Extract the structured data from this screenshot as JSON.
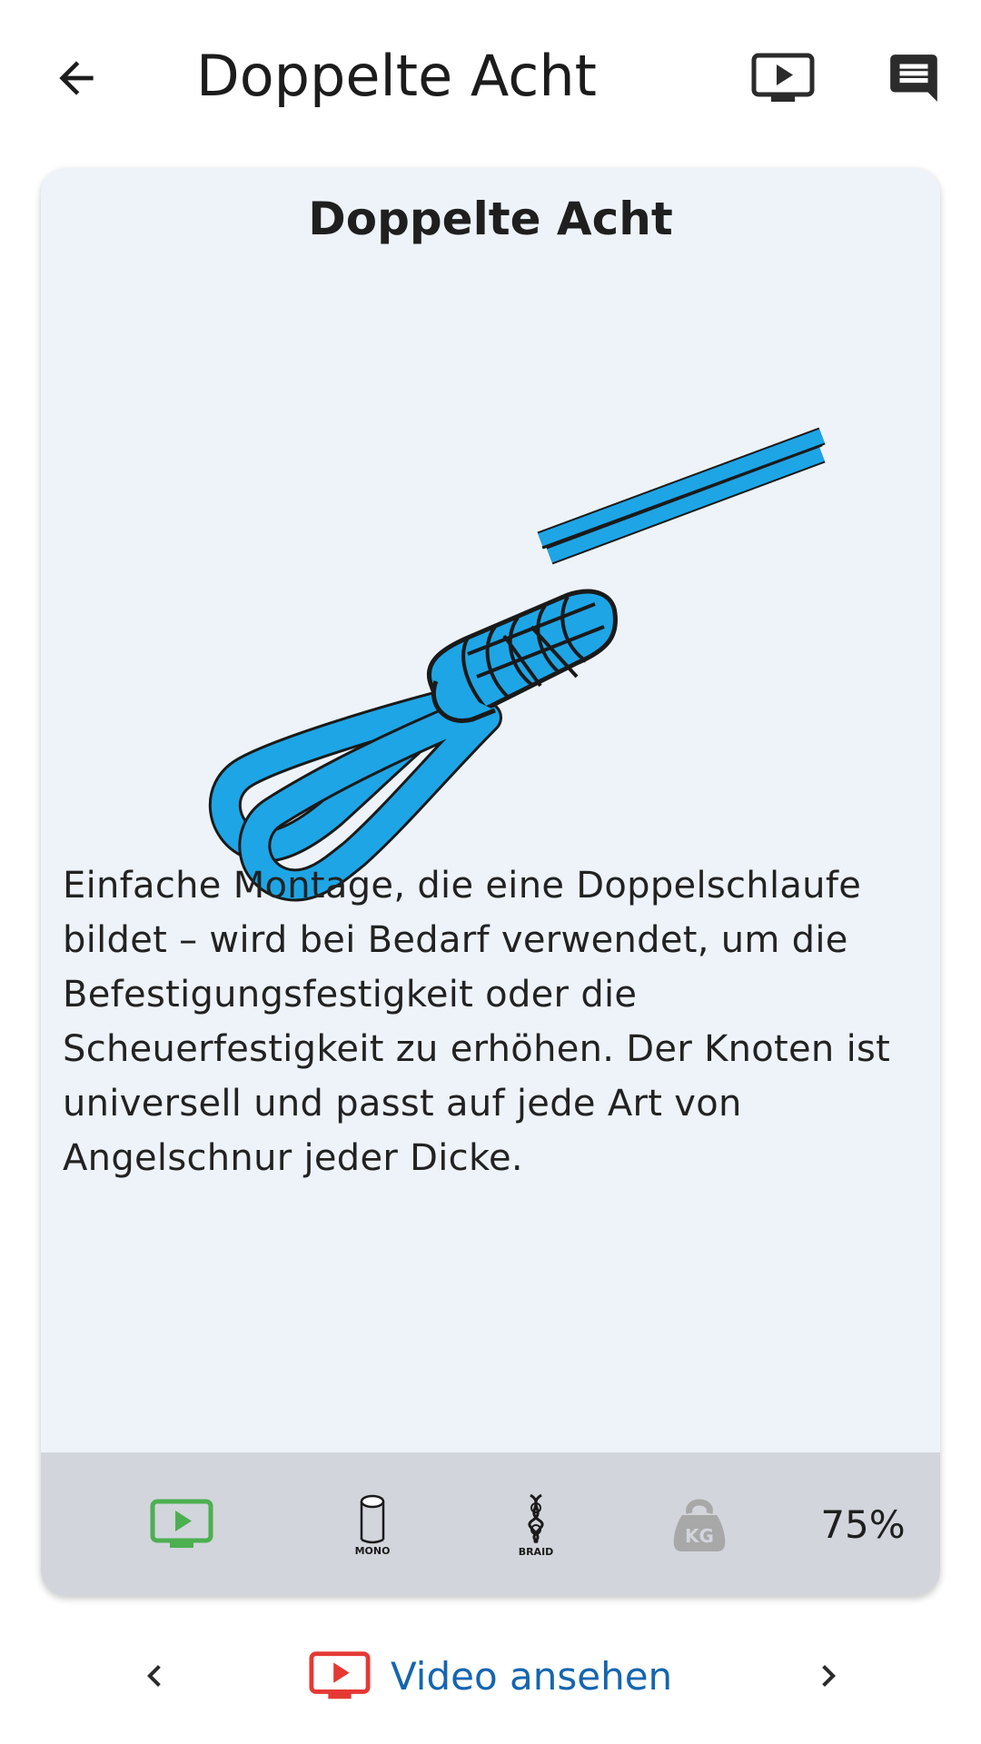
{
  "app_bar": {
    "title": "Doppelte Acht",
    "back_icon": "arrow-back-icon",
    "video_icon": "tv-play-icon",
    "comment_icon": "comment-icon"
  },
  "card": {
    "title": "Doppelte Acht",
    "image": "double-figure-eight-knot-illustration",
    "description": "Einfache Montage, die eine Doppelschlaufe bildet – wird bei Bedarf verwendet, um die Befestigungsfestigkeit oder die Scheuerfestigkeit zu erhöhen. Der Knoten ist universell und passt auf jede Art von Angelschnur jeder Dicke.",
    "footer": {
      "video_icon": "tv-play-icon",
      "mono_label": "MONO",
      "braid_label": "BRAID",
      "weight_label": "KG",
      "strength": "75%"
    }
  },
  "bottom_nav": {
    "prev_icon": "chevron-left-icon",
    "next_icon": "chevron-right-icon",
    "video_label": "Video ansehen"
  },
  "colors": {
    "rope": "#1ea5e6",
    "video_green": "#4caf50",
    "video_red": "#e53935",
    "link_blue": "#1565b0",
    "card_bg": "#eef3f9",
    "footer_bg": "#d2d5dc"
  }
}
